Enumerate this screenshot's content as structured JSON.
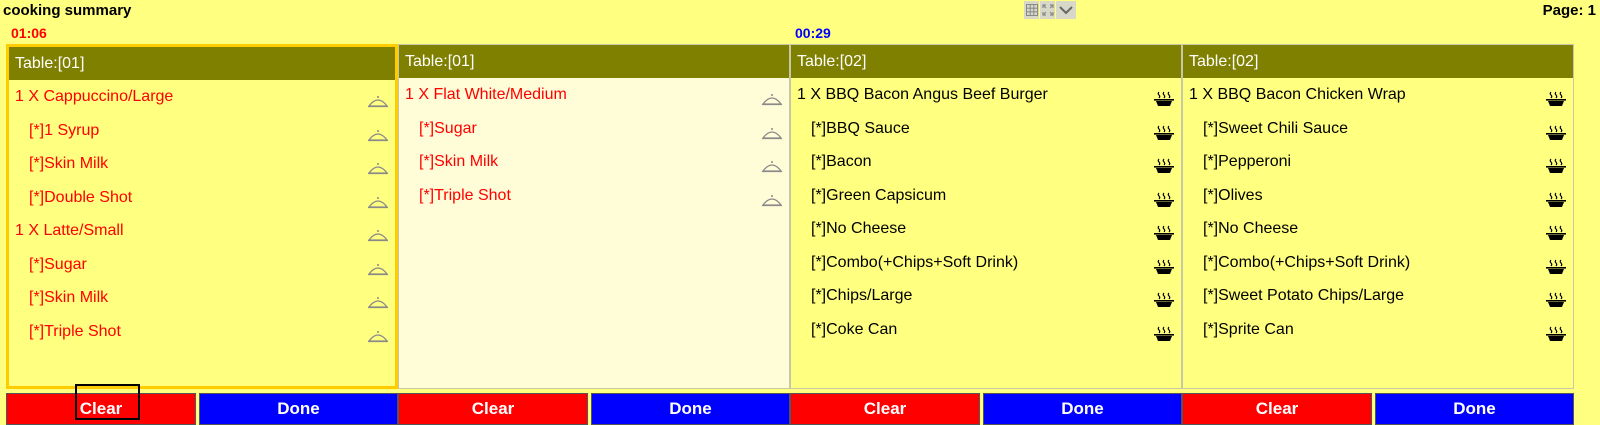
{
  "app": {
    "title": "cooking summary",
    "page_label": "Page:  1"
  },
  "toolbar": {
    "icons": [
      "grid-icon",
      "expand-icon",
      "chevron-down-icon"
    ]
  },
  "panels": [
    {
      "timer": "01:06",
      "header": "Table:[01]",
      "selected": true,
      "status_icon": "cloche-icon",
      "items": [
        {
          "text": "1 X  Cappuccino/Large",
          "mod": false
        },
        {
          "text": "[*]1 Syrup",
          "mod": true
        },
        {
          "text": "[*]Skin Milk",
          "mod": true
        },
        {
          "text": "[*]Double Shot",
          "mod": true
        },
        {
          "text": "1 X  Latte/Small",
          "mod": false
        },
        {
          "text": "[*]Sugar",
          "mod": true
        },
        {
          "text": "[*]Skin Milk",
          "mod": true
        },
        {
          "text": "[*]Triple Shot",
          "mod": true
        }
      ],
      "clear_label": "Clear",
      "done_label": "Done"
    },
    {
      "timer": "",
      "header": "Table:[01]",
      "selected": false,
      "status_icon": "cloche-icon",
      "items": [
        {
          "text": "1 X  Flat White/Medium",
          "mod": false
        },
        {
          "text": "[*]Sugar",
          "mod": true
        },
        {
          "text": "[*]Skin Milk",
          "mod": true
        },
        {
          "text": "[*]Triple Shot",
          "mod": true
        }
      ],
      "clear_label": "Clear",
      "done_label": "Done"
    },
    {
      "timer": "00:29",
      "header": "Table:[02]",
      "selected": false,
      "status_icon": "cooking-pot-icon",
      "items": [
        {
          "text": "1 X  BBQ Bacon Angus Beef Burger",
          "mod": false
        },
        {
          "text": "[*]BBQ Sauce",
          "mod": true
        },
        {
          "text": "[*]Bacon",
          "mod": true
        },
        {
          "text": "[*]Green Capsicum",
          "mod": true
        },
        {
          "text": "[*]No Cheese",
          "mod": true
        },
        {
          "text": "[*]Combo(+Chips+Soft Drink)",
          "mod": true
        },
        {
          "text": "[*]Chips/Large",
          "mod": true
        },
        {
          "text": "[*]Coke Can",
          "mod": true
        }
      ],
      "clear_label": "Clear",
      "done_label": "Done"
    },
    {
      "timer": "",
      "header": "Table:[02]",
      "selected": false,
      "status_icon": "cooking-pot-icon",
      "items": [
        {
          "text": "1 X  BBQ Bacon Chicken Wrap",
          "mod": false
        },
        {
          "text": "[*]Sweet Chili Sauce",
          "mod": true
        },
        {
          "text": "[*]Pepperoni",
          "mod": true
        },
        {
          "text": "[*]Olives",
          "mod": true
        },
        {
          "text": "[*]No Cheese",
          "mod": true
        },
        {
          "text": "[*]Combo(+Chips+Soft Drink)",
          "mod": true
        },
        {
          "text": "[*]Sweet Potato Chips/Large",
          "mod": true
        },
        {
          "text": "[*]Sprite Can",
          "mod": true
        }
      ],
      "clear_label": "Clear",
      "done_label": "Done"
    }
  ],
  "colors": {
    "background": "#ffff80",
    "header": "#808000",
    "pending_text": "#ff0000",
    "cooking_text": "#000000",
    "clear_button": "#ff0000",
    "done_button": "#0000ff",
    "selected_border": "#ffcc00"
  }
}
